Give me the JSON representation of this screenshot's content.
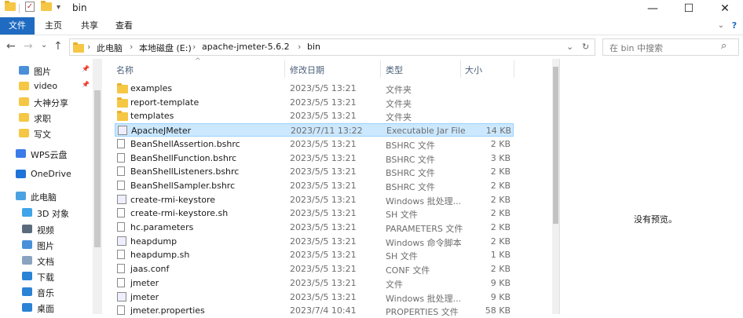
{
  "window": {
    "title": "bin",
    "controls": {
      "minimize": "—",
      "maximize": "☐",
      "close": "✕"
    }
  },
  "ribbon": {
    "tabs": [
      "文件",
      "主页",
      "共享",
      "查看"
    ],
    "help": "?"
  },
  "address": {
    "nav": {
      "back": "←",
      "forward": "→",
      "recent": "⌄",
      "up": "↑"
    },
    "path": [
      "此电脑",
      "本地磁盘 (E:)",
      "apache-jmeter-5.6.2",
      "bin"
    ],
    "path_sep": "›",
    "dropdown": "⌄",
    "refresh": "↻",
    "search_placeholder": "在 bin 中搜索"
  },
  "sidebar": {
    "items": [
      {
        "label": "图片",
        "icon": "pictures-icon",
        "pinned": true
      },
      {
        "label": "video",
        "icon": "folder-icon",
        "pinned": true
      },
      {
        "label": "大神分享",
        "icon": "folder-icon",
        "pinned": false
      },
      {
        "label": "求职",
        "icon": "folder-icon",
        "pinned": false
      },
      {
        "label": "写文",
        "icon": "folder-icon",
        "pinned": false
      },
      {
        "label": "WPS云盘",
        "icon": "wps-cloud-icon",
        "pinned": false
      },
      {
        "label": "OneDrive",
        "icon": "onedrive-icon",
        "pinned": false
      },
      {
        "label": "此电脑",
        "icon": "this-pc-icon",
        "pinned": false
      },
      {
        "label": "3D 对象",
        "icon": "3d-objects-icon",
        "pinned": false
      },
      {
        "label": "视频",
        "icon": "videos-icon",
        "pinned": false
      },
      {
        "label": "图片",
        "icon": "pictures-icon",
        "pinned": false
      },
      {
        "label": "文档",
        "icon": "documents-icon",
        "pinned": false
      },
      {
        "label": "下载",
        "icon": "downloads-icon",
        "pinned": false
      },
      {
        "label": "音乐",
        "icon": "music-icon",
        "pinned": false
      },
      {
        "label": "桌面",
        "icon": "desktop-icon",
        "pinned": false
      }
    ],
    "pin_glyph": "📌"
  },
  "filelist": {
    "columns": {
      "name": "名称",
      "date": "修改日期",
      "type": "类型",
      "size": "大小"
    },
    "sort_glyph": "^",
    "rows": [
      {
        "name": "examples",
        "date": "2023/5/5 13:21",
        "type": "文件夹",
        "size": "",
        "icon": "folder-icon"
      },
      {
        "name": "report-template",
        "date": "2023/5/5 13:21",
        "type": "文件夹",
        "size": "",
        "icon": "folder-icon"
      },
      {
        "name": "templates",
        "date": "2023/5/5 13:21",
        "type": "文件夹",
        "size": "",
        "icon": "folder-icon"
      },
      {
        "name": "ApacheJMeter",
        "date": "2023/7/11 13:22",
        "type": "Executable Jar File",
        "size": "14 KB",
        "icon": "jar-icon",
        "selected": true
      },
      {
        "name": "BeanShellAssertion.bshrc",
        "date": "2023/5/5 13:21",
        "type": "BSHRC 文件",
        "size": "2 KB",
        "icon": "file-icon"
      },
      {
        "name": "BeanShellFunction.bshrc",
        "date": "2023/5/5 13:21",
        "type": "BSHRC 文件",
        "size": "3 KB",
        "icon": "file-icon"
      },
      {
        "name": "BeanShellListeners.bshrc",
        "date": "2023/5/5 13:21",
        "type": "BSHRC 文件",
        "size": "2 KB",
        "icon": "file-icon"
      },
      {
        "name": "BeanShellSampler.bshrc",
        "date": "2023/5/5 13:21",
        "type": "BSHRC 文件",
        "size": "2 KB",
        "icon": "file-icon"
      },
      {
        "name": "create-rmi-keystore",
        "date": "2023/5/5 13:21",
        "type": "Windows 批处理...",
        "size": "2 KB",
        "icon": "batch-icon"
      },
      {
        "name": "create-rmi-keystore.sh",
        "date": "2023/5/5 13:21",
        "type": "SH 文件",
        "size": "2 KB",
        "icon": "file-icon"
      },
      {
        "name": "hc.parameters",
        "date": "2023/5/5 13:21",
        "type": "PARAMETERS 文件",
        "size": "2 KB",
        "icon": "file-icon"
      },
      {
        "name": "heapdump",
        "date": "2023/5/5 13:21",
        "type": "Windows 命令脚本",
        "size": "2 KB",
        "icon": "batch-icon"
      },
      {
        "name": "heapdump.sh",
        "date": "2023/5/5 13:21",
        "type": "SH 文件",
        "size": "1 KB",
        "icon": "file-icon"
      },
      {
        "name": "jaas.conf",
        "date": "2023/5/5 13:21",
        "type": "CONF 文件",
        "size": "2 KB",
        "icon": "file-icon"
      },
      {
        "name": "jmeter",
        "date": "2023/5/5 13:21",
        "type": "文件",
        "size": "9 KB",
        "icon": "file-icon"
      },
      {
        "name": "jmeter",
        "date": "2023/5/5 13:21",
        "type": "Windows 批处理...",
        "size": "9 KB",
        "icon": "batch-icon"
      },
      {
        "name": "jmeter.properties",
        "date": "2023/7/4 10:41",
        "type": "PROPERTIES 文件",
        "size": "58 KB",
        "icon": "file-icon"
      }
    ]
  },
  "preview": {
    "empty_text": "没有预览。"
  }
}
